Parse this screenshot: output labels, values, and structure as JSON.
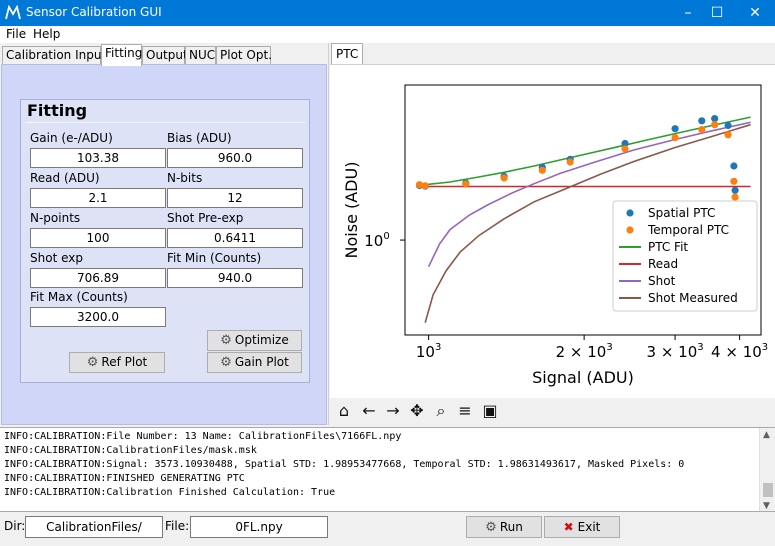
{
  "window": {
    "title": "Sensor Calibration GUI",
    "minimize": "–",
    "maximize": "☐",
    "close": "✕"
  },
  "menu": {
    "file": "File",
    "help": "Help"
  },
  "tabs": [
    "Calibration Inputs",
    "Fitting",
    "Output",
    "NUC",
    "Plot Opt."
  ],
  "active_tab": "Fitting",
  "fitting": {
    "title": "Fitting",
    "gain_label": "Gain (e-/ADU)",
    "gain_value": "103.38",
    "bias_label": "Bias (ADU)",
    "bias_value": "960.0",
    "read_label": "Read (ADU)",
    "read_value": "2.1",
    "nbits_label": "N-bits",
    "nbits_value": "12",
    "npoints_label": "N-points",
    "npoints_value": "100",
    "shotpre_label": "Shot Pre-exp",
    "shotpre_value": "0.6411",
    "shotexp_label": "Shot exp",
    "shotexp_value": "706.89",
    "fitmin_label": "Fit Min (Counts)",
    "fitmin_value": "940.0",
    "fitmax_label": "Fit Max (Counts)",
    "fitmax_value": "3200.0",
    "optimize_label": "Optimize",
    "refplot_label": "Ref Plot",
    "gainplot_label": "Gain Plot"
  },
  "plot_tab": "PTC",
  "chart_data": {
    "type": "scatter",
    "xlabel": "Signal (ADU)",
    "ylabel": "Noise (ADU)",
    "xscale": "log",
    "yscale": "log",
    "xlim": [
      900,
      4400
    ],
    "ylim": [
      0.28,
      8.0
    ],
    "xticks": [
      {
        "value": 1000,
        "label": "10",
        "sup": "3"
      },
      {
        "value": 2000,
        "label": "2 × 10",
        "sup": "3"
      },
      {
        "value": 3000,
        "label": "3 × 10",
        "sup": "3"
      },
      {
        "value": 4000,
        "label": "4 × 10",
        "sup": "3"
      }
    ],
    "yticks": [
      {
        "value": 1,
        "label": "10",
        "sup": "0"
      }
    ],
    "legend_position": "bottom-right",
    "series": [
      {
        "name": "Spatial PTC",
        "kind": "points",
        "color": "#1f77b4",
        "x": [
          960,
          985,
          1180,
          1400,
          1660,
          1880,
          2400,
          3000,
          3380,
          3580,
          3800,
          3900,
          3920
        ],
        "y": [
          2.08,
          2.06,
          2.15,
          2.35,
          2.65,
          2.95,
          3.65,
          4.45,
          4.95,
          5.1,
          4.65,
          2.7,
          1.95
        ]
      },
      {
        "name": "Temporal PTC",
        "kind": "points",
        "color": "#ff7f0e",
        "x": [
          960,
          985,
          1180,
          1400,
          1660,
          1880,
          2400,
          3000,
          3380,
          3580,
          3800,
          3900,
          3920
        ],
        "y": [
          2.1,
          2.07,
          2.12,
          2.3,
          2.55,
          2.85,
          3.4,
          3.95,
          4.4,
          4.7,
          4.1,
          2.2,
          1.78
        ]
      },
      {
        "name": "PTC Fit",
        "kind": "line",
        "color": "#2ca02c",
        "x": [
          985,
          1100,
          1250,
          1400,
          1600,
          1800,
          2000,
          2300,
          2600,
          3000,
          3400,
          3800,
          4200
        ],
        "y": [
          2.1,
          2.18,
          2.33,
          2.48,
          2.7,
          2.93,
          3.15,
          3.47,
          3.78,
          4.17,
          4.53,
          4.87,
          5.2
        ]
      },
      {
        "name": "Read",
        "kind": "line",
        "color": "#d62728",
        "x": [
          985,
          4200
        ],
        "y": [
          2.05,
          2.05
        ]
      },
      {
        "name": "Shot",
        "kind": "line",
        "color": "#9467bd",
        "x": [
          1000,
          1050,
          1100,
          1200,
          1300,
          1450,
          1600,
          1800,
          2100,
          2500,
          3000,
          3500,
          4200
        ],
        "y": [
          0.7,
          0.95,
          1.15,
          1.4,
          1.6,
          1.88,
          2.13,
          2.45,
          2.85,
          3.35,
          3.85,
          4.3,
          4.85
        ]
      },
      {
        "name": "Shot Measured",
        "kind": "line",
        "color": "#8c564b",
        "x": [
          985,
          1020,
          1080,
          1150,
          1250,
          1400,
          1600,
          1850,
          2150,
          2500,
          3000,
          3500,
          4200
        ],
        "y": [
          0.33,
          0.48,
          0.66,
          0.85,
          1.06,
          1.33,
          1.67,
          2.0,
          2.42,
          2.87,
          3.46,
          3.98,
          4.7
        ]
      }
    ]
  },
  "toolbar": {
    "home": "⌂",
    "back": "←",
    "forward": "→",
    "pan": "✥",
    "zoom": "⌕",
    "configure": "≡",
    "save": "▣"
  },
  "log": [
    "INFO:CALIBRATION:File Number: 13 Name: CalibrationFiles\\7166FL.npy",
    "INFO:CALIBRATION:CalibrationFiles/mask.msk",
    "INFO:CALIBRATION:Signal: 3573.10930488, Spatial STD: 1.98953477668, Temporal STD: 1.98631493617, Masked Pixels:  0",
    "INFO:CALIBRATION:FINISHED GENERATING PTC",
    "INFO:CALIBRATION:Calibration Finished Calculation: True"
  ],
  "bottom": {
    "dir_label": "Dir:",
    "dir_value": "CalibrationFiles/",
    "file_label": "File:",
    "file_value": "0FL.npy",
    "run_label": "Run",
    "exit_label": "Exit"
  },
  "colors": {
    "titlebar": "#0078d7",
    "panel": "#cfd6f7",
    "frame": "#dde2f7"
  }
}
